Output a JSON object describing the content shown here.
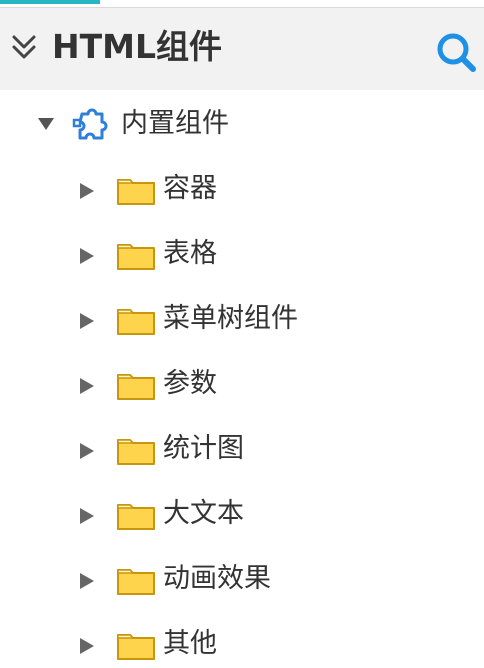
{
  "header": {
    "title": "HTML组件",
    "collapse_icon": "double-chevron-down-icon",
    "search_icon": "search-icon"
  },
  "tree": {
    "root": {
      "label": "内置组件",
      "icon": "puzzle-icon",
      "expanded": true
    },
    "children": [
      {
        "label": "容器",
        "icon": "folder-icon"
      },
      {
        "label": "表格",
        "icon": "folder-icon"
      },
      {
        "label": "菜单树组件",
        "icon": "folder-icon"
      },
      {
        "label": "参数",
        "icon": "folder-icon"
      },
      {
        "label": "统计图",
        "icon": "folder-icon"
      },
      {
        "label": "大文本",
        "icon": "folder-icon"
      },
      {
        "label": "动画效果",
        "icon": "folder-icon"
      },
      {
        "label": "其他",
        "icon": "folder-icon"
      }
    ]
  },
  "colors": {
    "accent": "#26b6c4",
    "search": "#1e90e6",
    "puzzle": "#2f7fd8",
    "folder_fill": "#ffd44d",
    "folder_stroke": "#c8950e",
    "caret": "#666666",
    "text": "#333333"
  }
}
